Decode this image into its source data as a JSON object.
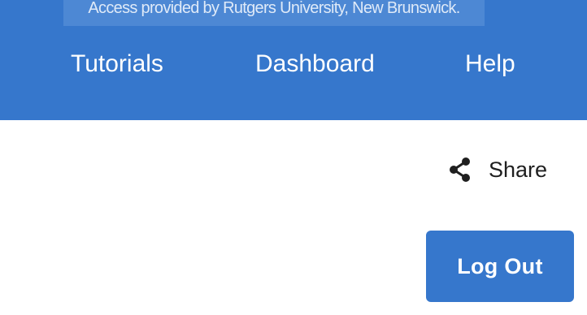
{
  "header": {
    "access_text": "Access provided by Rutgers University, New Brunswick.",
    "nav": {
      "tutorials": "Tutorials",
      "dashboard": "Dashboard",
      "help": "Help"
    }
  },
  "actions": {
    "share_label": "Share",
    "share_icon": "share-icon",
    "logout_label": "Log Out"
  },
  "colors": {
    "header_bg": "#3677cc",
    "banner_bg": "#4d88d4",
    "button_bg": "#3677cc",
    "text_dark": "#1f1f1f"
  }
}
